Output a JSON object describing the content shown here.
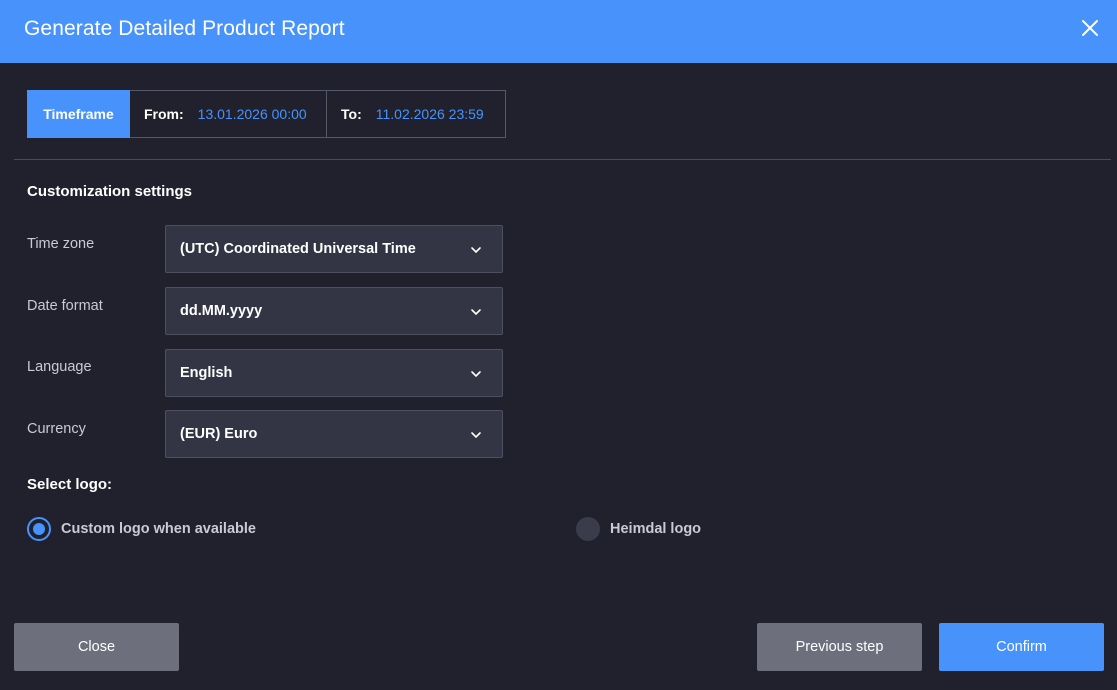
{
  "dialog": {
    "title": "Generate Detailed Product Report",
    "close_icon": "close-icon"
  },
  "timeframe": {
    "label": "Timeframe",
    "from_label": "From:",
    "from_value": "13.01.2026 00:00",
    "to_label": "To:",
    "to_value": "11.02.2026 23:59"
  },
  "customization": {
    "title": "Customization settings",
    "fields": [
      {
        "label": "Time zone",
        "value": "(UTC) Coordinated Universal Time"
      },
      {
        "label": "Date format",
        "value": "dd.MM.yyyy"
      },
      {
        "label": "Language",
        "value": "English"
      },
      {
        "label": "Currency",
        "value": "(EUR) Euro"
      }
    ]
  },
  "logo": {
    "title": "Select logo:",
    "options": [
      {
        "label": "Custom logo when available",
        "selected": true
      },
      {
        "label": "Heimdal logo",
        "selected": false
      }
    ]
  },
  "footer": {
    "close_label": "Close",
    "previous_label": "Previous step",
    "confirm_label": "Confirm"
  },
  "colors": {
    "accent": "#4793fb",
    "background": "#20212d",
    "secondary_button": "#6d707c"
  }
}
